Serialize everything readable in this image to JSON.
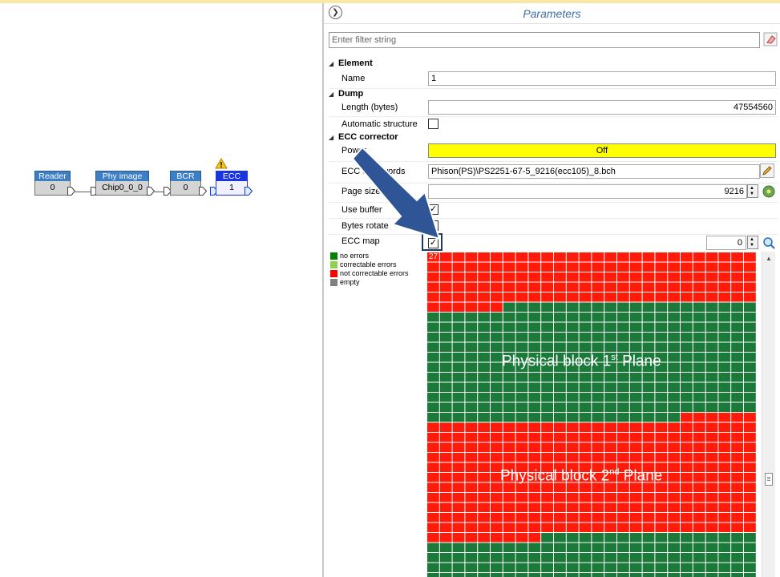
{
  "graph": {
    "nodes": [
      {
        "title": "Reader",
        "value": "0"
      },
      {
        "title": "Phy image",
        "value": "Chip0_0_0"
      },
      {
        "title": "BCR",
        "value": "0"
      },
      {
        "title": "ECC",
        "value": "1",
        "warning": true,
        "selected": true
      }
    ]
  },
  "panel": {
    "title": "Parameters",
    "filter_placeholder": "Enter filter string",
    "sections": {
      "element": "Element",
      "dump": "Dump",
      "ecc": "ECC corrector"
    },
    "rows": {
      "name_label": "Name",
      "name_value": "1",
      "length_label": "Length (bytes)",
      "length_value": "47554560",
      "auto_struct_label": "Automatic structure",
      "auto_struct_checked": false,
      "power_label": "Power",
      "power_value": "Off",
      "codewords_label": "ECC codewords",
      "codewords_value": "Phison(PS)\\PS2251-67-5_9216(ecc105)_8.bch",
      "page_label": "Page size",
      "page_value": "9216",
      "use_buffer_label": "Use buffer",
      "use_buffer_checked": true,
      "bytes_rotate_label": "Bytes rotate",
      "bytes_rotate_checked": false,
      "ecc_map_label": "ECC map",
      "ecc_map_checked": true
    },
    "ecc_map": {
      "counter": "0",
      "badge": "27",
      "label_plane1": "Physical block 1",
      "label_plane1_sup": "st",
      "label_plane1_end": " Plane",
      "label_plane2": "Physical block 2",
      "label_plane2_sup": "nd",
      "label_plane2_end": " Plane"
    },
    "legend": [
      {
        "label": "no errors",
        "color": "#008000"
      },
      {
        "label": "correctable errors",
        "color": "#8fd14f"
      },
      {
        "label": "not correctable errors",
        "color": "#ff0000"
      },
      {
        "label": "empty",
        "color": "#808080"
      }
    ]
  },
  "colors": {
    "red": "#ff1a0a",
    "green": "#1b7a3a",
    "power": "#ffff00",
    "arrow": "#2f5597"
  }
}
